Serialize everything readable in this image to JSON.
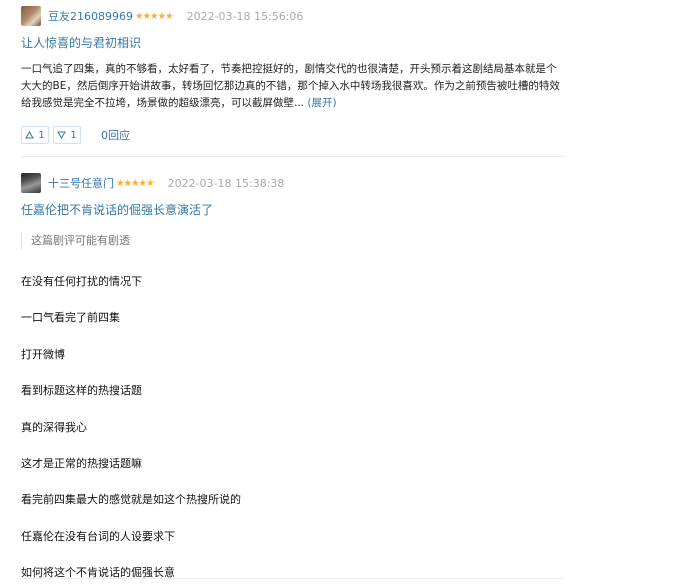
{
  "reviews": [
    {
      "username": "豆友216089969",
      "stars": "★★★★★",
      "date": "2022-03-18 15:56:06",
      "title": "让人惊喜的与君初相识",
      "body_lines": [
        "一口气追了四集，真的不够看，太好看了，节奏把控挺好的，剧情交代的也很清楚，开头预示着这剧结局基本就是个",
        "大大的BE，然后倒序开始讲故事，转场回忆那边真的不错，那个掉入水中转场我很喜欢。作为之前预告被吐槽的特效",
        "给我感觉是完全不拉垮，场景做的超级漂亮，可以截屏做壁..."
      ],
      "expand": "(展开)",
      "up_count": "1",
      "down_count": "1",
      "reply": "0回应"
    },
    {
      "username": "十三号任意门",
      "stars": "★★★★★",
      "date": "2022-03-18 15:38:38",
      "title": "任嘉伦把不肯说话的倔强长意演活了",
      "spoiler": "这篇剧评可能有剧透",
      "paragraphs": [
        "在没有任何打扰的情况下",
        "一口气看完了前四集",
        "打开微博",
        "看到标题这样的热搜话题",
        "真的深得我心",
        "这才是正常的热搜话题嘛",
        "看完前四集最大的感觉就是如这个热搜所说的",
        "任嘉伦在没有台词的人设要求下",
        "如何将这个不肯说话的倔强长意"
      ]
    }
  ],
  "icons": {
    "up": "triangle-up-icon",
    "down": "triangle-down-icon"
  },
  "colors": {
    "link": "#3377aa",
    "star": "#ffac2d",
    "date": "#aaaaaa"
  }
}
